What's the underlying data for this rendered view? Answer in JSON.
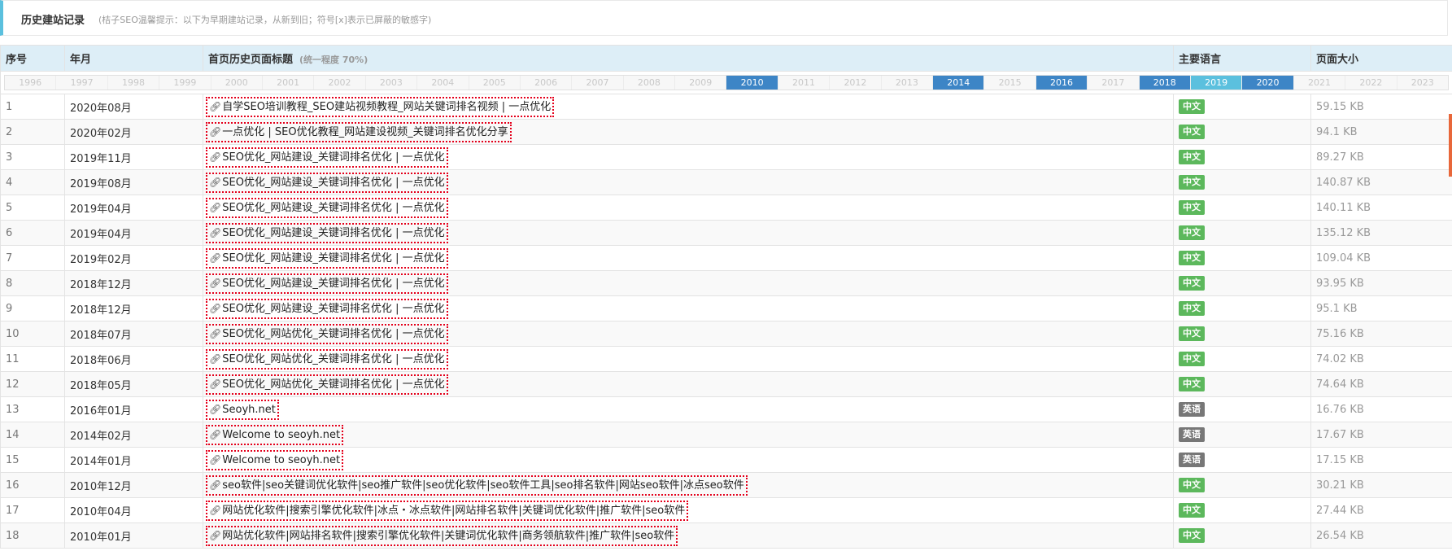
{
  "panel": {
    "title": "历史建站记录",
    "hint": "(桔子SEO温馨提示：以下为早期建站记录，从新到旧；符号[x]表示已屏蔽的敏感字)"
  },
  "columns": {
    "index": "序号",
    "month": "年月",
    "title": "首页历史页面标题",
    "title_note": "(统一程度 70%)",
    "lang": "主要语言",
    "size": "页面大小"
  },
  "years": [
    {
      "label": "1996",
      "state": "inactive"
    },
    {
      "label": "1997",
      "state": "inactive"
    },
    {
      "label": "1998",
      "state": "inactive"
    },
    {
      "label": "1999",
      "state": "inactive"
    },
    {
      "label": "2000",
      "state": "inactive"
    },
    {
      "label": "2001",
      "state": "inactive"
    },
    {
      "label": "2002",
      "state": "inactive"
    },
    {
      "label": "2003",
      "state": "inactive"
    },
    {
      "label": "2004",
      "state": "inactive"
    },
    {
      "label": "2005",
      "state": "inactive"
    },
    {
      "label": "2006",
      "state": "inactive"
    },
    {
      "label": "2007",
      "state": "inactive"
    },
    {
      "label": "2008",
      "state": "inactive"
    },
    {
      "label": "2009",
      "state": "inactive"
    },
    {
      "label": "2010",
      "state": "active"
    },
    {
      "label": "2011",
      "state": "inactive"
    },
    {
      "label": "2012",
      "state": "inactive"
    },
    {
      "label": "2013",
      "state": "inactive"
    },
    {
      "label": "2014",
      "state": "active"
    },
    {
      "label": "2015",
      "state": "inactive"
    },
    {
      "label": "2016",
      "state": "active"
    },
    {
      "label": "2017",
      "state": "inactive"
    },
    {
      "label": "2018",
      "state": "active"
    },
    {
      "label": "2019",
      "state": "light"
    },
    {
      "label": "2020",
      "state": "active"
    },
    {
      "label": "2021",
      "state": "inactive"
    },
    {
      "label": "2022",
      "state": "inactive"
    },
    {
      "label": "2023",
      "state": "inactive"
    }
  ],
  "rows": [
    {
      "no": "1",
      "month": "2020年08月",
      "title": "自学SEO培训教程_SEO建站视频教程_网站关键词排名视频 | 一点优化",
      "lang": "中文",
      "lang_type": "zh",
      "size": "59.15 KB"
    },
    {
      "no": "2",
      "month": "2020年02月",
      "title": "一点优化 | SEO优化教程_网站建设视频_关键词排名优化分享",
      "lang": "中文",
      "lang_type": "zh",
      "size": "94.1 KB"
    },
    {
      "no": "3",
      "month": "2019年11月",
      "title": "SEO优化_网站建设_关键词排名优化 | 一点优化",
      "lang": "中文",
      "lang_type": "zh",
      "size": "89.27 KB"
    },
    {
      "no": "4",
      "month": "2019年08月",
      "title": "SEO优化_网站建设_关键词排名优化 | 一点优化",
      "lang": "中文",
      "lang_type": "zh",
      "size": "140.87 KB"
    },
    {
      "no": "5",
      "month": "2019年04月",
      "title": "SEO优化_网站建设_关键词排名优化 | 一点优化",
      "lang": "中文",
      "lang_type": "zh",
      "size": "140.11 KB"
    },
    {
      "no": "6",
      "month": "2019年04月",
      "title": "SEO优化_网站建设_关键词排名优化 | 一点优化",
      "lang": "中文",
      "lang_type": "zh",
      "size": "135.12 KB"
    },
    {
      "no": "7",
      "month": "2019年02月",
      "title": "SEO优化_网站建设_关键词排名优化 | 一点优化",
      "lang": "中文",
      "lang_type": "zh",
      "size": "109.04 KB"
    },
    {
      "no": "8",
      "month": "2018年12月",
      "title": "SEO优化_网站建设_关键词排名优化 | 一点优化",
      "lang": "中文",
      "lang_type": "zh",
      "size": "93.95 KB"
    },
    {
      "no": "9",
      "month": "2018年12月",
      "title": "SEO优化_网站建设_关键词排名优化 | 一点优化",
      "lang": "中文",
      "lang_type": "zh",
      "size": "95.1 KB"
    },
    {
      "no": "10",
      "month": "2018年07月",
      "title": "SEO优化_网站优化_关键词排名优化 | 一点优化",
      "lang": "中文",
      "lang_type": "zh",
      "size": "75.16 KB"
    },
    {
      "no": "11",
      "month": "2018年06月",
      "title": "SEO优化_网站优化_关键词排名优化 | 一点优化",
      "lang": "中文",
      "lang_type": "zh",
      "size": "74.02 KB"
    },
    {
      "no": "12",
      "month": "2018年05月",
      "title": "SEO优化_网站优化_关键词排名优化 | 一点优化",
      "lang": "中文",
      "lang_type": "zh",
      "size": "74.64 KB"
    },
    {
      "no": "13",
      "month": "2016年01月",
      "title": "Seoyh.net",
      "lang": "英语",
      "lang_type": "en",
      "size": "16.76 KB"
    },
    {
      "no": "14",
      "month": "2014年02月",
      "title": "Welcome to seoyh.net",
      "lang": "英语",
      "lang_type": "en",
      "size": "17.67 KB"
    },
    {
      "no": "15",
      "month": "2014年01月",
      "title": "Welcome to seoyh.net",
      "lang": "英语",
      "lang_type": "en",
      "size": "17.15 KB"
    },
    {
      "no": "16",
      "month": "2010年12月",
      "title": "seo软件|seo关键词优化软件|seo推广软件|seo优化软件|seo软件工具|seo排名软件|网站seo软件|冰点seo软件",
      "lang": "中文",
      "lang_type": "zh",
      "size": "30.21 KB"
    },
    {
      "no": "17",
      "month": "2010年04月",
      "title": "网站优化软件|搜索引擎优化软件|冰点・冰点软件|网站排名软件|关键词优化软件|推广软件|seo软件",
      "lang": "中文",
      "lang_type": "zh",
      "size": "27.44 KB"
    },
    {
      "no": "18",
      "month": "2010年01月",
      "title": "网站优化软件|网站排名软件|搜索引擎优化软件|关键词优化软件|商务领航软件|推广软件|seo软件",
      "lang": "中文",
      "lang_type": "zh",
      "size": "26.54 KB"
    }
  ],
  "colors": {
    "accent": "#5bc0de",
    "active_year": "#3d85c6",
    "header_bg": "#ddeef7",
    "lang_zh": "#5cb85c",
    "lang_en": "#777777",
    "title_border": "#e4001b",
    "scroll_thumb": "#e8673a"
  },
  "icons": {
    "title_link": "link-icon"
  }
}
